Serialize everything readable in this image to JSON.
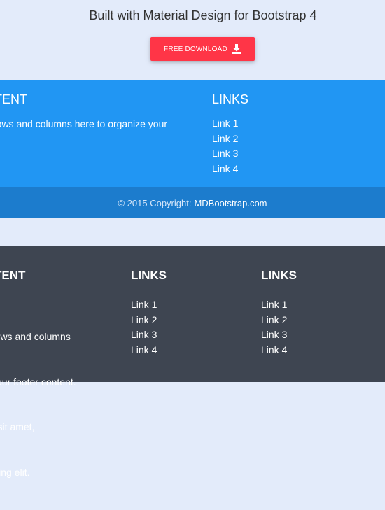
{
  "promo": {
    "title": "Built with Material Design for Bootstrap 4",
    "button_label": "FREE DOWNLOAD",
    "button_icon": "download-icon",
    "button_color": "#ff3547"
  },
  "footer_blue": {
    "background": "#2196f3",
    "content_title": "TENT",
    "content_text": "rows and columns here to organize your",
    "links_title": "LINKS",
    "links": [
      "Link 1",
      "Link 2",
      "Link 3",
      "Link 4"
    ]
  },
  "copyright": {
    "text": "© 2015 Copyright:",
    "link": "MDBootstrap.com",
    "background": "#1c7ccd"
  },
  "footer_dark": {
    "background": "#3e4551",
    "content_title": "TENT",
    "content_lines": [
      "rows and columns",
      "your footer content.",
      "r sit amet,",
      "icing elit."
    ],
    "links_title_1": "LINKS",
    "links_1": [
      "Link 1",
      "Link 2",
      "Link 3",
      "Link 4"
    ],
    "links_title_2": "LINKS",
    "links_2": [
      "Link 1",
      "Link 2",
      "Link 3",
      "Link 4"
    ]
  }
}
